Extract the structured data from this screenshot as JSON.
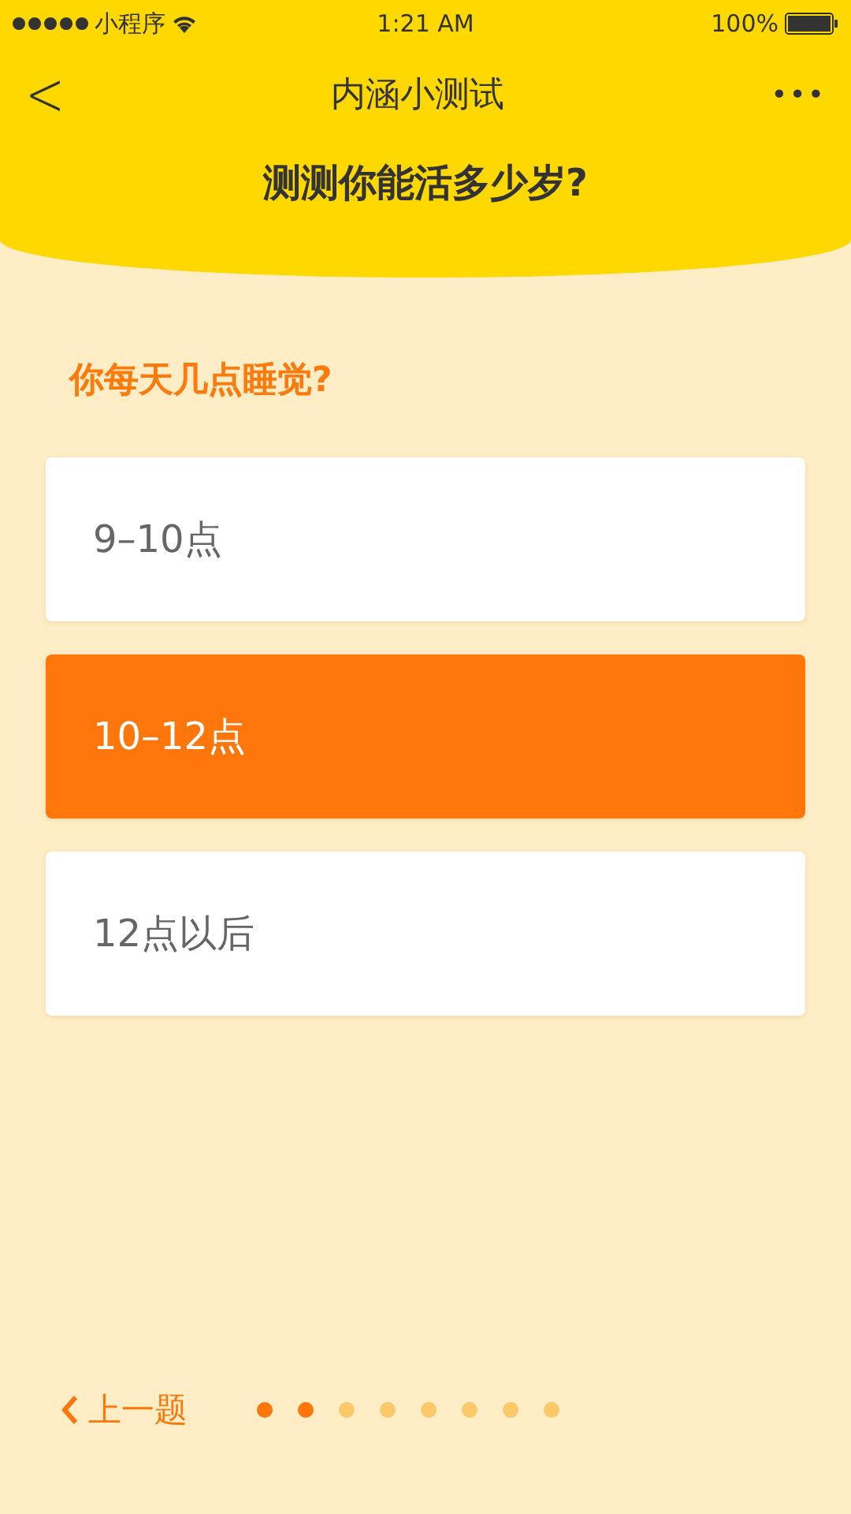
{
  "status_bar": {
    "carrier": "小程序",
    "time": "1:21 AM",
    "battery": "100%"
  },
  "nav": {
    "back": "<",
    "title": "内涵小测试",
    "more": "•••"
  },
  "header": {
    "title": "测测你能活多少岁?"
  },
  "question": "你每天几点睡觉?",
  "options": [
    {
      "label": "9–10点",
      "selected": false
    },
    {
      "label": "10–12点",
      "selected": true
    },
    {
      "label": "12点以后",
      "selected": false
    }
  ],
  "footer": {
    "prev": "上一题",
    "dots": [
      {
        "done": true
      },
      {
        "done": true
      },
      {
        "done": false
      },
      {
        "done": false
      },
      {
        "done": false
      },
      {
        "done": false
      },
      {
        "done": false
      },
      {
        "done": false
      }
    ]
  }
}
